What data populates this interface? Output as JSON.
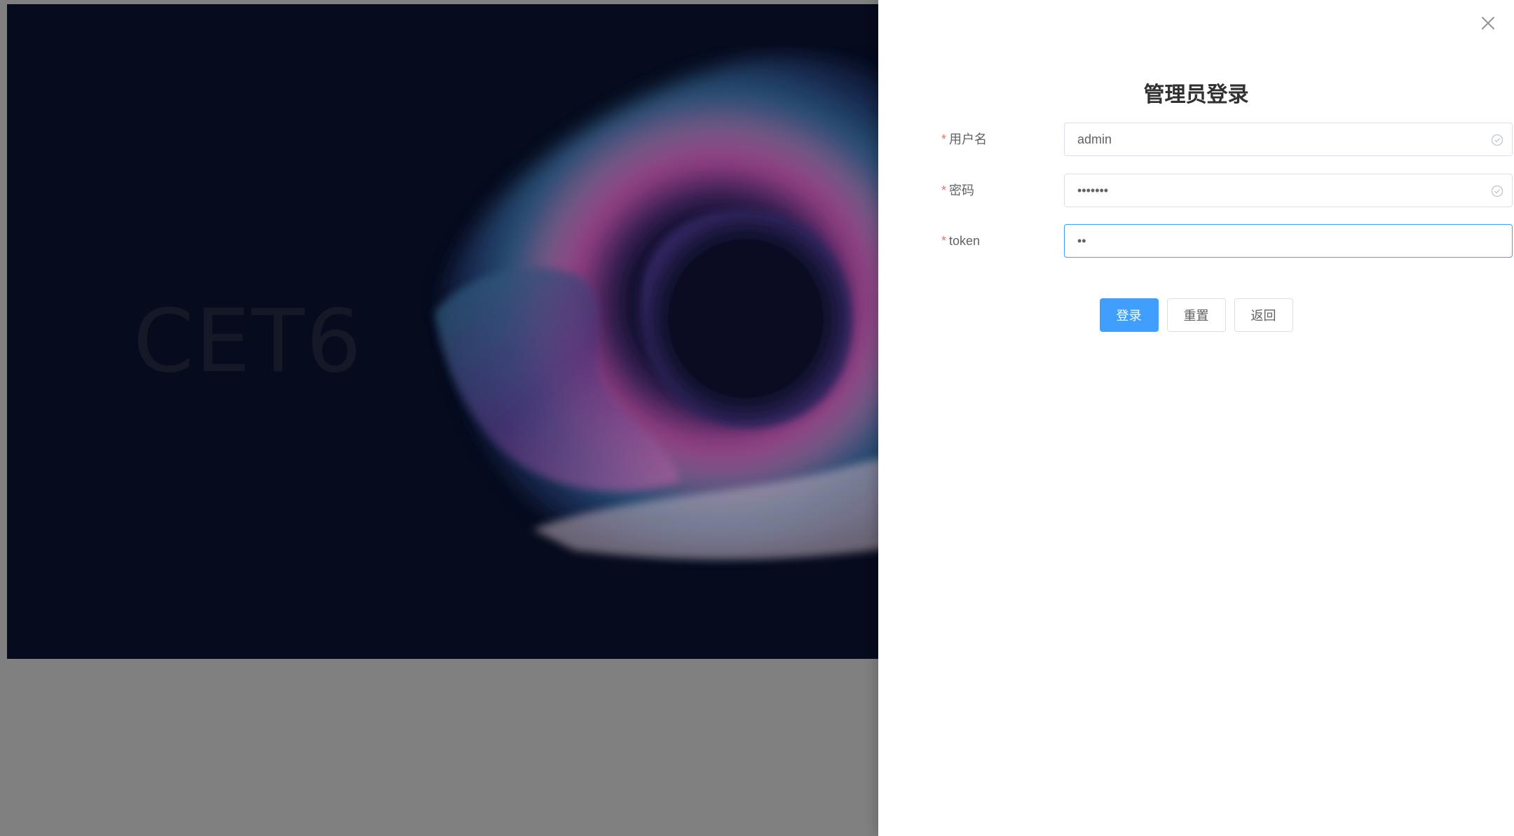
{
  "hero": {
    "title": "CET6"
  },
  "drawer": {
    "title": "管理员登录",
    "close_icon": "close-icon"
  },
  "form": {
    "username": {
      "label": "用户名",
      "value": "admin",
      "status_icon": "check-circle-icon"
    },
    "password": {
      "label": "密码",
      "value": "•••••••",
      "status_icon": "check-circle-icon"
    },
    "token": {
      "label": "token",
      "value": "••"
    },
    "required_mark": "*"
  },
  "buttons": {
    "login": "登录",
    "reset": "重置",
    "back": "返回"
  },
  "colors": {
    "primary": "#409eff",
    "required": "#f56c6c",
    "hero_bg": "#070d22"
  }
}
